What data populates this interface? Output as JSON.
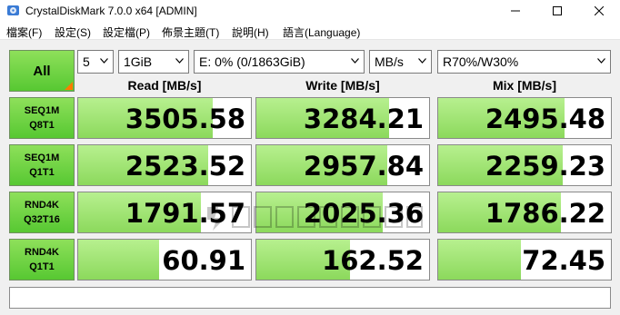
{
  "window": {
    "title": "CrystalDiskMark 7.0.0 x64 [ADMIN]",
    "icons": {
      "minimize": "minimize-icon",
      "maximize": "maximize-icon",
      "close": "close-icon"
    }
  },
  "menu": {
    "items": [
      "檔案(F)",
      "設定(S)",
      "設定檔(P)",
      "佈景主題(T)",
      "說明(H)",
      "語言(Language)"
    ]
  },
  "controls": {
    "all_label": "All",
    "count": "5",
    "size": "1GiB",
    "drive": "E: 0% (0/1863GiB)",
    "unit": "MB/s",
    "mix": "R70%/W30%"
  },
  "columns": [
    "Read [MB/s]",
    "Write [MB/s]",
    "Mix [MB/s]"
  ],
  "rows": [
    {
      "line1": "SEQ1M",
      "line2": "Q8T1",
      "read": "3505.58",
      "write": "3284.21",
      "mix": "2495.48"
    },
    {
      "line1": "SEQ1M",
      "line2": "Q1T1",
      "read": "2523.52",
      "write": "2957.84",
      "mix": "2259.23"
    },
    {
      "line1": "RND4K",
      "line2": "Q32T16",
      "read": "1791.57",
      "write": "2025.36",
      "mix": "1786.22"
    },
    {
      "line1": "RND4K",
      "line2": "Q1T1",
      "read": "60.91",
      "write": "162.52",
      "mix": "72.45"
    }
  ],
  "bar_fill": [
    {
      "read": 0.78,
      "write": 0.77,
      "mix": 0.73
    },
    {
      "read": 0.75,
      "write": 0.76,
      "mix": 0.72
    },
    {
      "read": 0.71,
      "write": 0.73,
      "mix": 0.71
    },
    {
      "read": 0.47,
      "write": 0.54,
      "mix": 0.48
    }
  ],
  "colors": {
    "accent_green": "#57c832",
    "bar_green": "#8cd95c",
    "corner_orange": "#ff7a00"
  }
}
